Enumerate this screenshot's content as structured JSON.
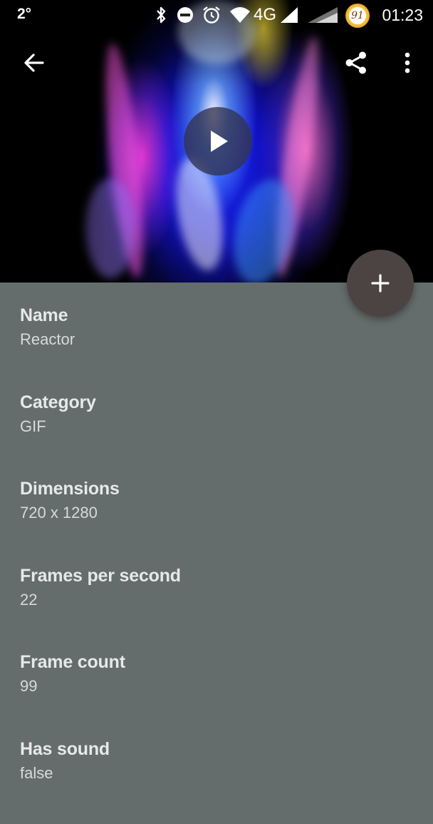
{
  "status_bar": {
    "temperature": "2°",
    "network": "4G",
    "badge": "91",
    "time": "01:23"
  },
  "toolbar": {
    "back_icon": "arrow-back-icon",
    "share_icon": "share-icon",
    "more_icon": "more-vert-icon"
  },
  "player": {
    "play_icon": "play-icon"
  },
  "fab": {
    "icon": "add-icon",
    "color": "#4c4442"
  },
  "colors": {
    "background": "#646d6b",
    "label": "#e6e9e8",
    "value": "#d5dbd9"
  },
  "details": [
    {
      "label": "Name",
      "value": "Reactor"
    },
    {
      "label": "Category",
      "value": "GIF"
    },
    {
      "label": "Dimensions",
      "value": "720 x 1280"
    },
    {
      "label": "Frames per second",
      "value": "22"
    },
    {
      "label": "Frame count",
      "value": "99"
    },
    {
      "label": "Has sound",
      "value": "false"
    }
  ]
}
